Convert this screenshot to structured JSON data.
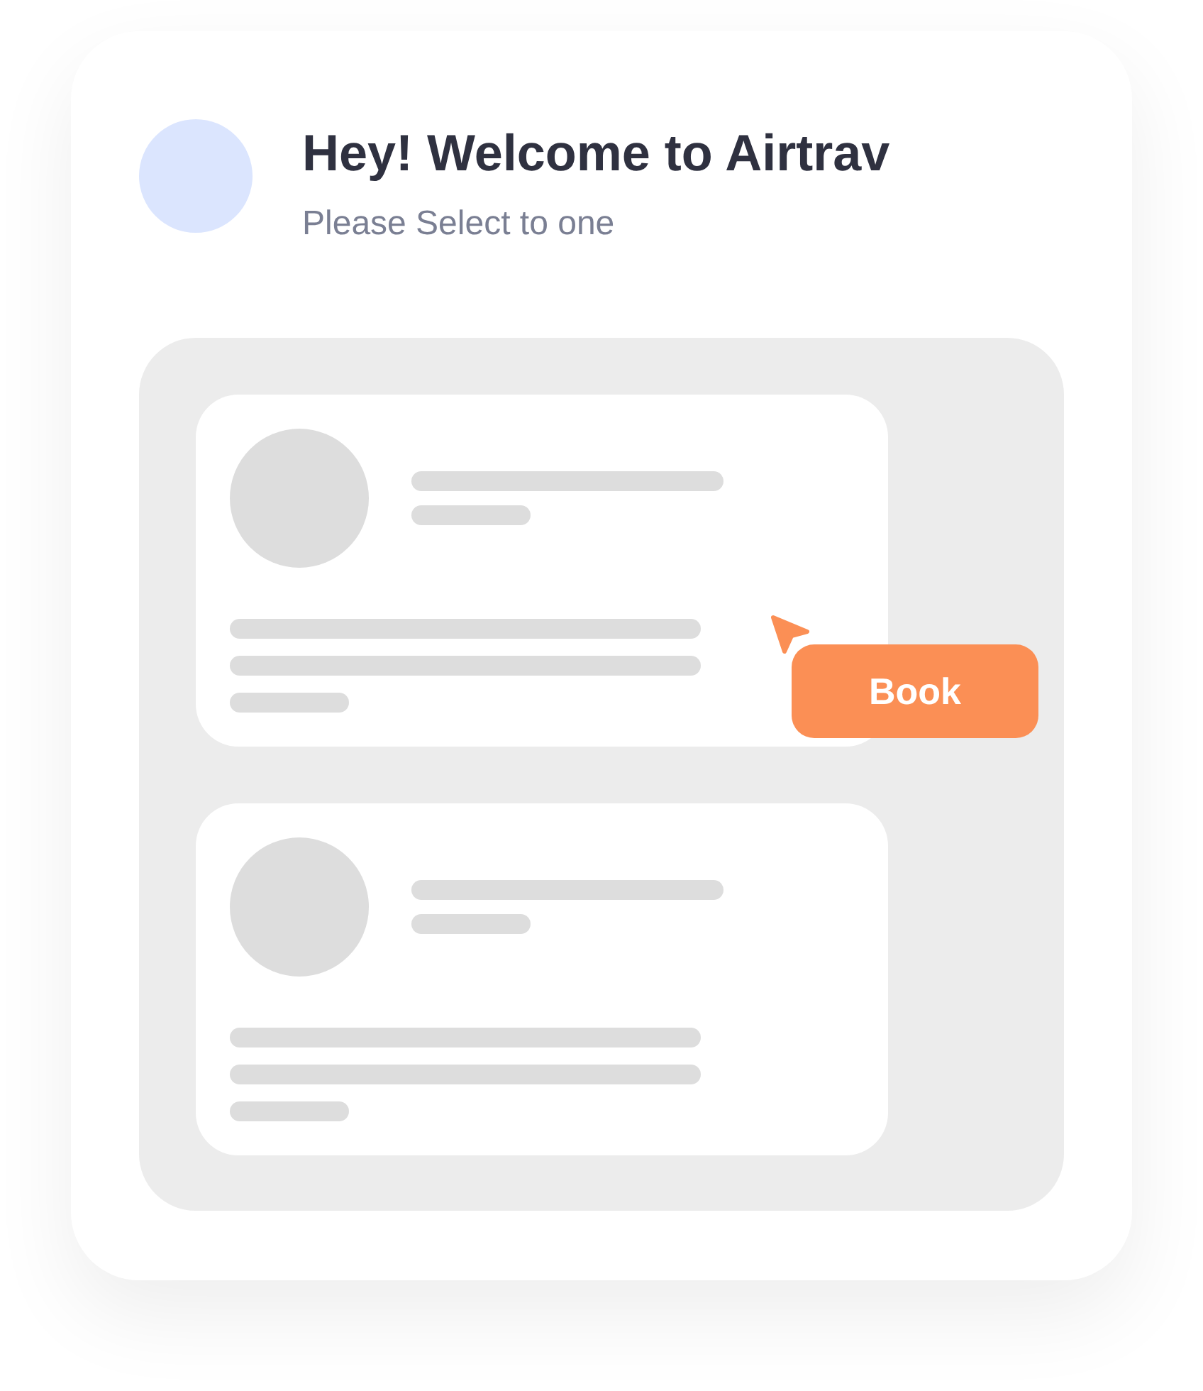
{
  "header": {
    "title": "Hey! Welcome to Airtrav",
    "subtitle": "Please Select to one"
  },
  "book_button": {
    "label": "Book"
  }
}
